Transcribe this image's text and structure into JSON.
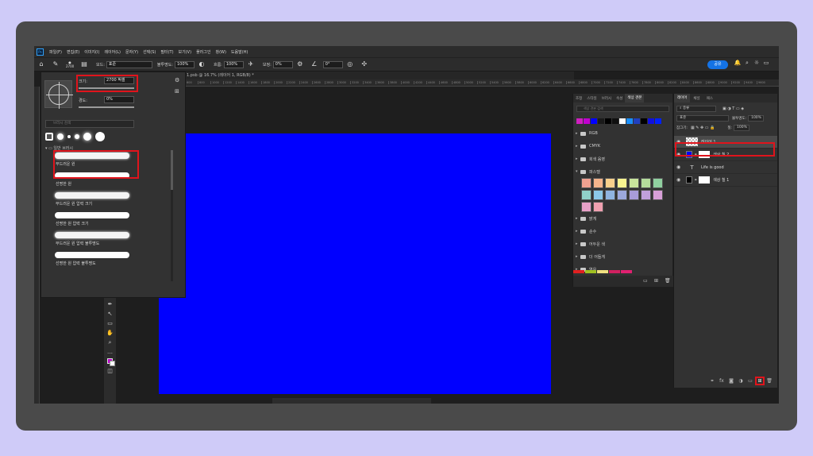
{
  "app": {
    "logo": "Ps",
    "menu": [
      "파일(F)",
      "편집(E)",
      "이미지(I)",
      "레이어(L)",
      "문자(Y)",
      "선택(S)",
      "필터(T)",
      "보기(V)",
      "플러그인",
      "창(W)",
      "도움말(H)"
    ]
  },
  "options_bar": {
    "brush_size_small": "2700",
    "mode_label": "모드:",
    "mode_value": "표준",
    "opacity_label": "불투명도:",
    "opacity_value": "100%",
    "flow_label": "흐름:",
    "flow_value": "100%",
    "smoothing_label": "보정:",
    "smoothing_value": "0%",
    "angle_value": "0°",
    "share_label": "공유"
  },
  "document": {
    "tab_title": "1.psb @ 16.7% (레이어 1, RGB/8) *",
    "ruler_ticks": [
      "600",
      "800",
      "1000",
      "1200",
      "1400",
      "1600",
      "1800",
      "2000",
      "2200",
      "2400",
      "2600",
      "2800",
      "3000",
      "3200",
      "3400",
      "3600",
      "3800",
      "4000",
      "4200",
      "4400",
      "4600",
      "4800",
      "5000",
      "5200",
      "5400",
      "5600",
      "5800",
      "6000",
      "6200",
      "6400",
      "6600",
      "6800",
      "7000",
      "7200",
      "7400",
      "7600",
      "7800",
      "8000",
      "8200",
      "8400",
      "8600",
      "8800",
      "9000",
      "9200",
      "9400",
      "9600"
    ],
    "canvas_color": "#0000ff"
  },
  "brush_panel": {
    "size_label": "크기:",
    "size_value": "2700 픽셀",
    "hardness_label": "경도:",
    "hardness_value": "0%",
    "search_placeholder": "브러시 검색",
    "folder_label": "일반 브러시",
    "brushes": [
      {
        "name": "부드러운 원",
        "style": "soft"
      },
      {
        "name": "선명한 원",
        "style": "hard"
      },
      {
        "name": "부드러운 원 압력 크기",
        "style": "soft"
      },
      {
        "name": "선명한 원 압력 크기",
        "style": "hard"
      },
      {
        "name": "부드러운 원 압력 불투명도",
        "style": "soft"
      },
      {
        "name": "선명한 원 압력 불투명도",
        "style": "hard"
      }
    ]
  },
  "swatches_panel": {
    "tabs": [
      "조정",
      "스타일",
      "브러시",
      "속성",
      "색상 견본"
    ],
    "active_tab": "색상 견본",
    "search_placeholder": "색상 견본 검색",
    "recent": [
      "#d020c0",
      "#c000d0",
      "#0000ff",
      "#1a1a1a",
      "#000000",
      "#101010",
      "#ffffff",
      "#1a90ff",
      "#2040c0",
      "#000000",
      "#1010e0",
      "#0020ff"
    ],
    "groups": [
      "RGB",
      "CMYK",
      "회색 음영",
      "파스텔",
      "밝게",
      "순수",
      "어두운 색",
      "더 어둡게",
      "옅은"
    ],
    "pastel_colors": [
      "#f0a090",
      "#f4b48c",
      "#f8d08c",
      "#f8f490",
      "#c8e49c",
      "#b4dc9c",
      "#90d0a0",
      "#90d0c8",
      "#8cc8e8",
      "#90b4e0",
      "#9ca8dc",
      "#a89cd8",
      "#c0a0dc",
      "#d8a0d8",
      "#e8a0c8",
      "#f0a0b0"
    ],
    "bottom_colors": [
      "#e02020",
      "#a0c020",
      "#f0e080",
      "#d02060",
      "#e02070"
    ]
  },
  "layers_panel": {
    "tabs": [
      "레이어",
      "채널",
      "패스"
    ],
    "active_tab": "레이어",
    "filter_label": "종류",
    "blend_mode": "표준",
    "opacity_label": "불투명도:",
    "opacity_value": "100%",
    "lock_label": "잠그기:",
    "fill_label": "칠:",
    "fill_value": "100%",
    "layers": [
      {
        "name": "레이어 1",
        "kind": "pixel",
        "selected": true
      },
      {
        "name": "색상 칠 2",
        "kind": "fill-blue",
        "selected": false
      },
      {
        "name": "Life is good",
        "kind": "text",
        "selected": false
      },
      {
        "name": "색상 칠 1",
        "kind": "fill-black",
        "selected": false
      }
    ]
  }
}
